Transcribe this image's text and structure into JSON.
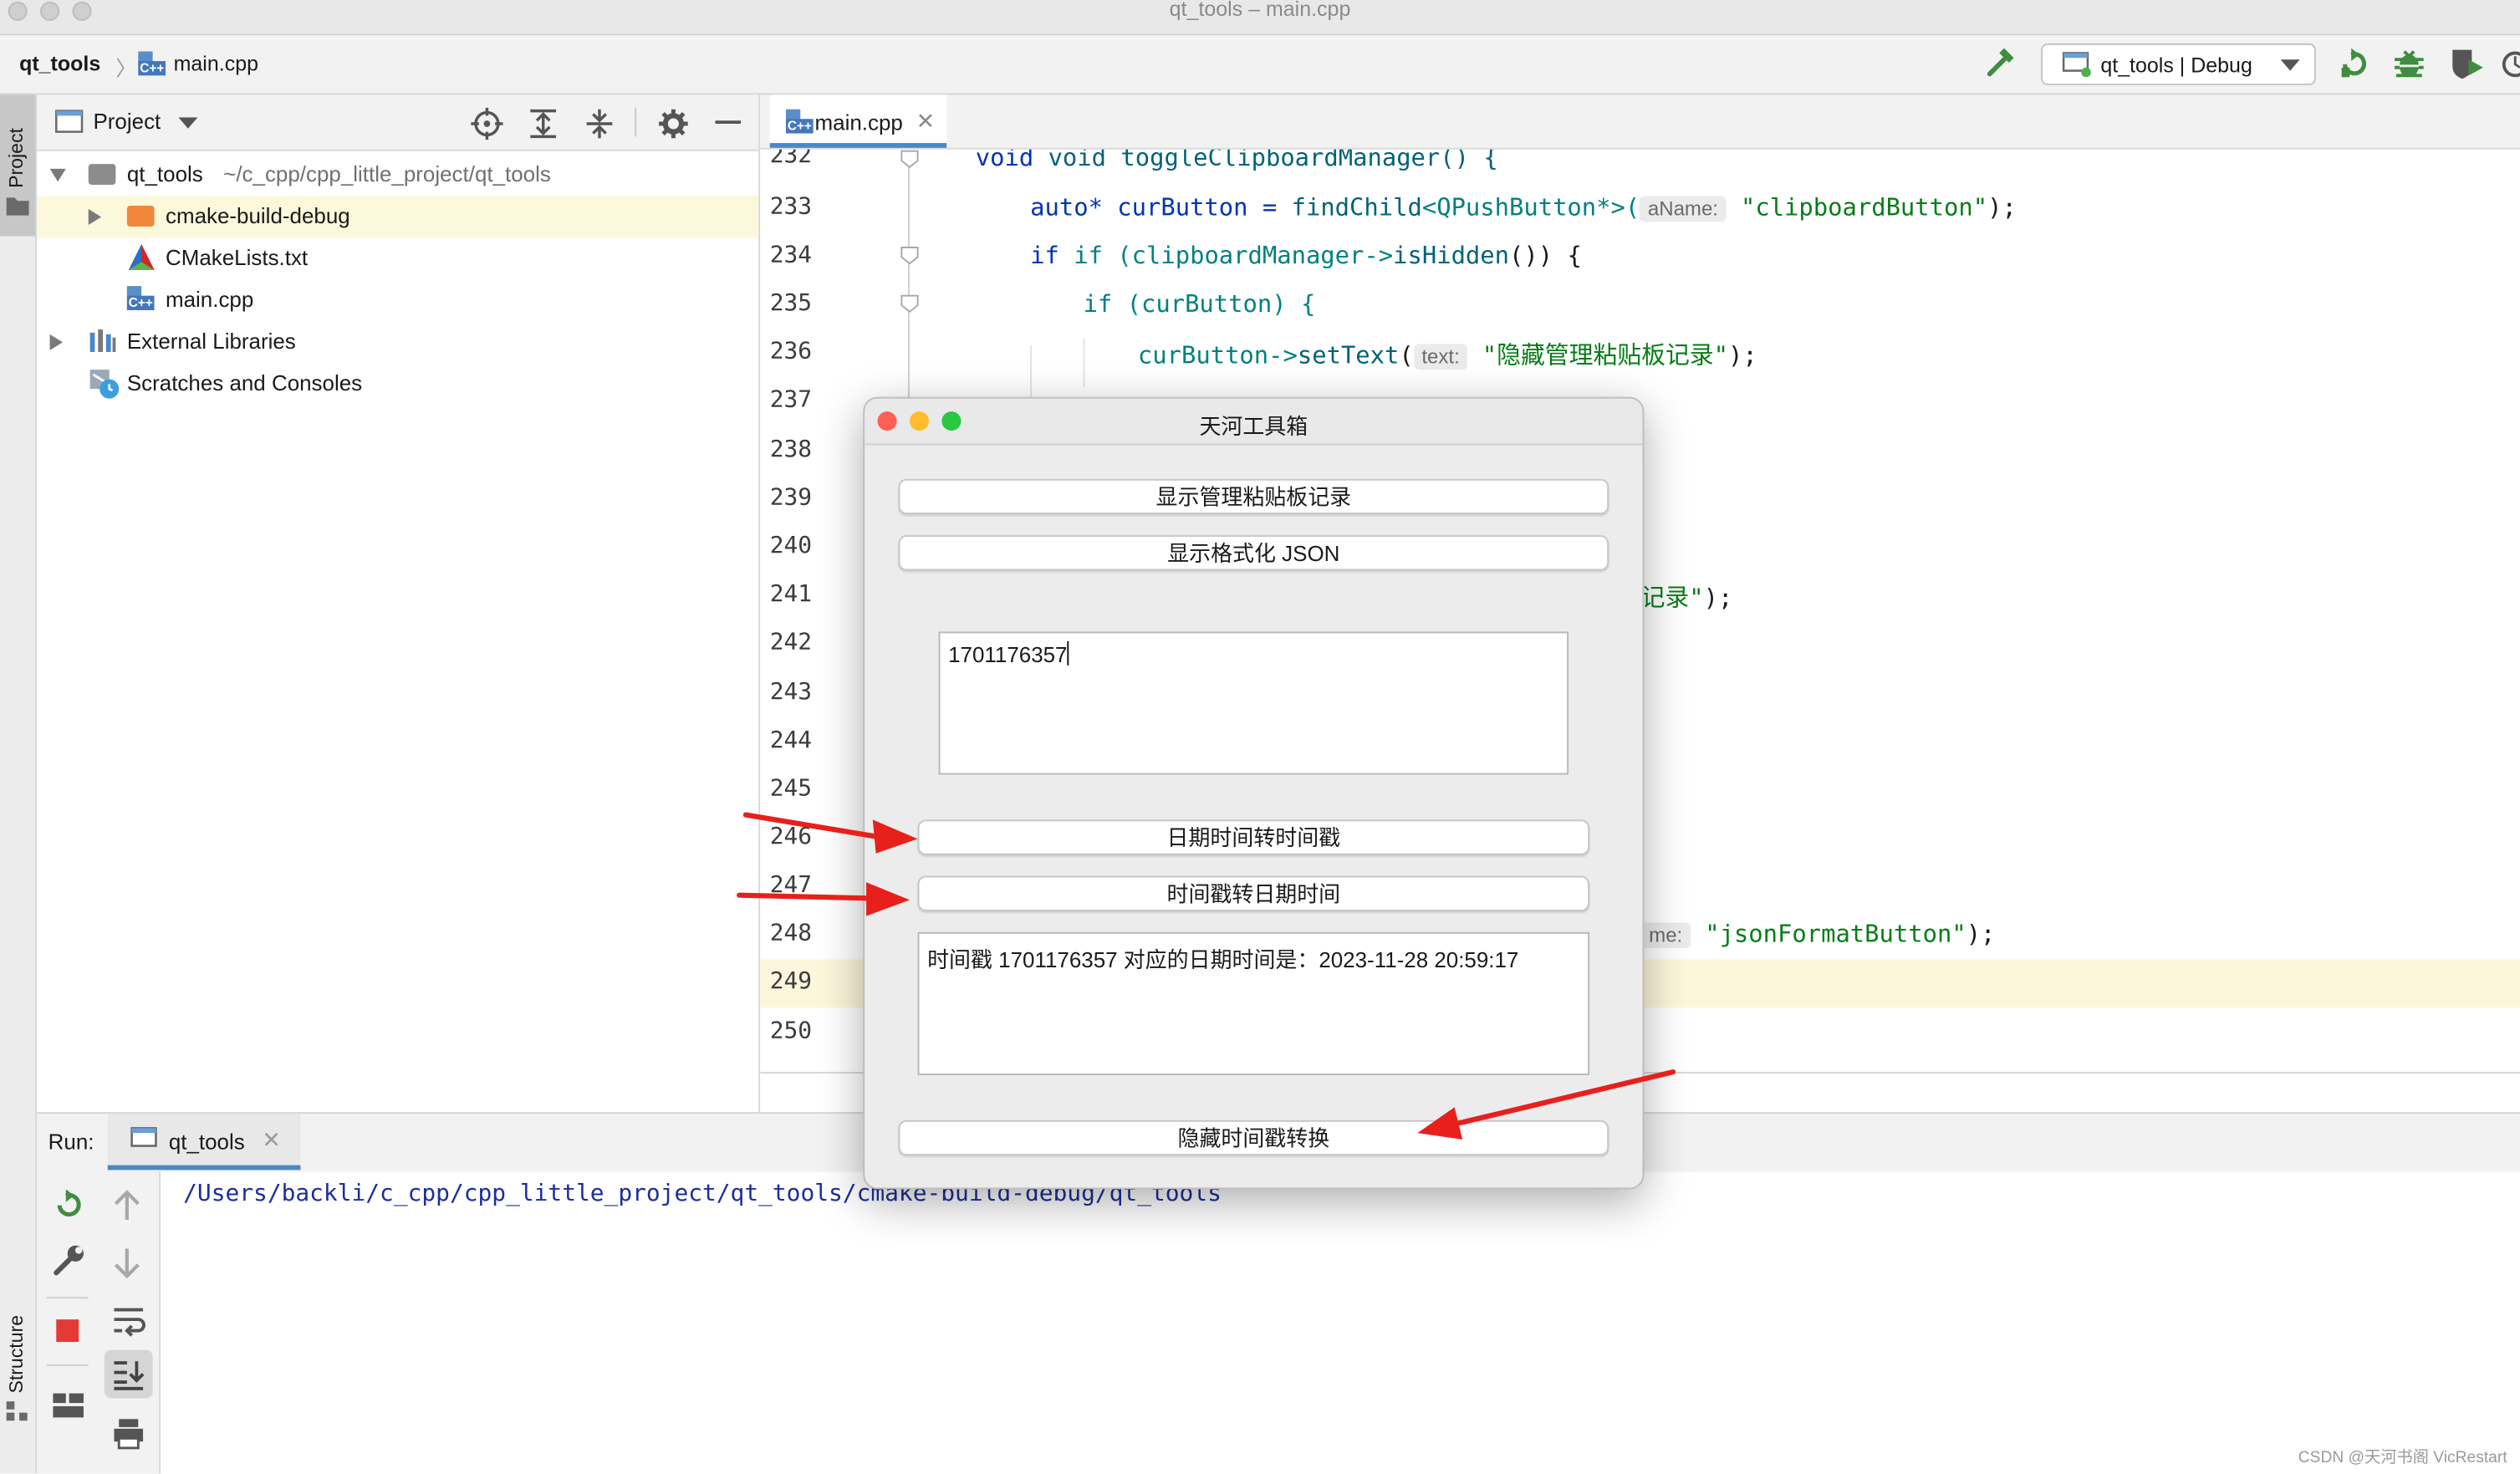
{
  "window": {
    "title": "qt_tools – main.cpp"
  },
  "navbar": {
    "project": "qt_tools",
    "file": "main.cpp",
    "run_config": "qt_tools | Debug"
  },
  "left_stripe": {
    "project_tab": "Project",
    "structure_tab": "Structure"
  },
  "project_panel": {
    "header": "Project",
    "tree": [
      {
        "label": "qt_tools",
        "path": "~/c_cpp/cpp_little_project/qt_tools"
      },
      {
        "label": "cmake-build-debug"
      },
      {
        "label": "CMakeLists.txt"
      },
      {
        "label": "main.cpp"
      },
      {
        "label": "External Libraries"
      },
      {
        "label": "Scratches and Consoles"
      }
    ]
  },
  "editor": {
    "tab": "main.cpp",
    "lines": [
      "232",
      "233",
      "234",
      "235",
      "236",
      "237",
      "238",
      "239",
      "240",
      "241",
      "242",
      "243",
      "244",
      "245",
      "246",
      "247",
      "248",
      "249",
      "250"
    ],
    "code": {
      "l232": "void toggleClipboardManager() {",
      "l233_a": "auto* curButton = ",
      "l233_b": "findChild",
      "l233_c": "<QPushButton*>(",
      "l233_hint": "aName:",
      "l233_str": "\"clipboardButton\"",
      "l233_end": ");",
      "l234_a": "if (clipboardManager->",
      "l234_b": "isHidden",
      "l234_c": "()) {",
      "l235": "if (curButton) {",
      "l236_a": "curButton->",
      "l236_b": "setText",
      "l236_c": "(",
      "l236_hint": "text:",
      "l236_str": "\"隐藏管理粘贴板记录\"",
      "l236_end": ");",
      "l241_str": "记录\"",
      "l241_end": ");",
      "l248_hint": "me:",
      "l248_str": "\"jsonFormatButton\"",
      "l248_end": ");"
    }
  },
  "run_panel": {
    "label": "Run:",
    "tab": "qt_tools",
    "output": "/Users/backli/c_cpp/cpp_little_project/qt_tools/cmake-build-debug/qt_tools"
  },
  "dialog": {
    "title": "天河工具箱",
    "buttons": {
      "clipboard": "显示管理粘贴板记录",
      "json": "显示格式化 JSON",
      "dt_to_ts": "日期时间转时间戳",
      "ts_to_dt": "时间戳转日期时间",
      "hide": "隐藏时间戳转换"
    },
    "input_value": "1701176357",
    "result_text": "时间戳 1701176357 对应的日期时间是：2023-11-28 20:59:17"
  },
  "watermark": "CSDN @天河书阁 VicRestart",
  "colors": {
    "annotation_arrow": "#e8201c",
    "highlight_line": "#fcf6dc",
    "selected_row": "#fcf8db"
  }
}
